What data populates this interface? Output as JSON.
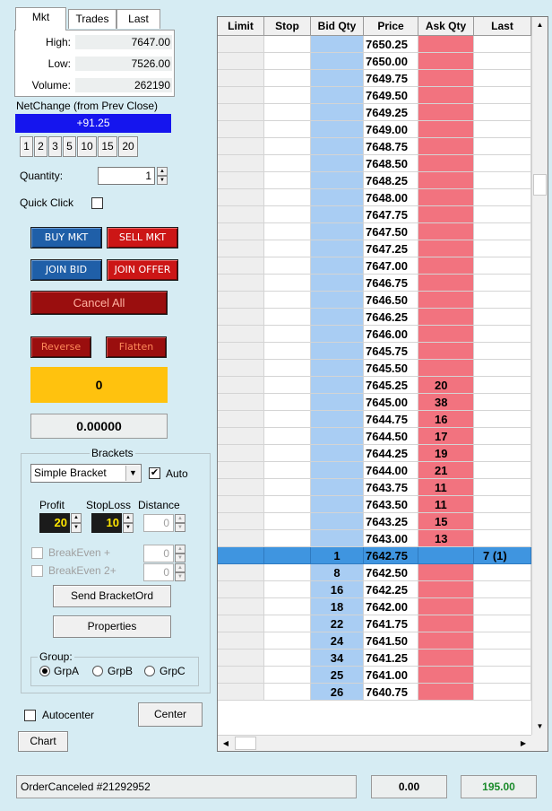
{
  "tabs": [
    "Mkt",
    "Trades",
    "Last"
  ],
  "market": {
    "high_label": "High:",
    "high": "7647.00",
    "low_label": "Low:",
    "low": "7526.00",
    "volume_label": "Volume:",
    "volume": "262190"
  },
  "netchange": {
    "label": "NetChange (from Prev Close)",
    "value": "+91.25"
  },
  "quantity_buttons": [
    "1",
    "2",
    "3",
    "5",
    "10",
    "15",
    "20"
  ],
  "quantity": {
    "label": "Quantity:",
    "value": "1"
  },
  "quick_click_label": "Quick Click",
  "orders": {
    "buy_mkt": "BUY MKT",
    "sell_mkt": "SELL MKT",
    "join_bid": "JOIN BID",
    "join_offer": "JOIN OFFER",
    "cancel_all": "Cancel All",
    "reverse": "Reverse",
    "flatten": "Flatten"
  },
  "position": "0",
  "pnl": "0.00000",
  "brackets": {
    "title": "Brackets",
    "type": "Simple Bracket",
    "auto_label": "Auto",
    "auto_checked": true,
    "profit_label": "Profit",
    "profit": "20",
    "stoploss_label": "StopLoss",
    "stoploss": "10",
    "distance_label": "Distance",
    "distance": "0",
    "breakeven_label": "BreakEven +",
    "breakeven": "0",
    "breakeven2_label": "BreakEven 2+",
    "breakeven2": "0",
    "send_label": "Send BracketOrd",
    "properties_label": "Properties"
  },
  "group": {
    "title": "Group:",
    "options": [
      "GrpA",
      "GrpB",
      "GrpC"
    ],
    "selected": "GrpA"
  },
  "autocenter_label": "Autocenter",
  "center_label": "Center",
  "chart_label": "Chart",
  "ladder": {
    "headers": [
      "Limit",
      "Stop",
      "Bid Qty",
      "Price",
      "Ask Qty",
      "Last"
    ],
    "rows": [
      {
        "price": "7650.25",
        "bid": "",
        "ask": "",
        "last": ""
      },
      {
        "price": "7650.00",
        "bid": "",
        "ask": "",
        "last": ""
      },
      {
        "price": "7649.75",
        "bid": "",
        "ask": "",
        "last": ""
      },
      {
        "price": "7649.50",
        "bid": "",
        "ask": "",
        "last": ""
      },
      {
        "price": "7649.25",
        "bid": "",
        "ask": "",
        "last": ""
      },
      {
        "price": "7649.00",
        "bid": "",
        "ask": "",
        "last": ""
      },
      {
        "price": "7648.75",
        "bid": "",
        "ask": "",
        "last": ""
      },
      {
        "price": "7648.50",
        "bid": "",
        "ask": "",
        "last": ""
      },
      {
        "price": "7648.25",
        "bid": "",
        "ask": "",
        "last": ""
      },
      {
        "price": "7648.00",
        "bid": "",
        "ask": "",
        "last": ""
      },
      {
        "price": "7647.75",
        "bid": "",
        "ask": "",
        "last": ""
      },
      {
        "price": "7647.50",
        "bid": "",
        "ask": "",
        "last": ""
      },
      {
        "price": "7647.25",
        "bid": "",
        "ask": "",
        "last": ""
      },
      {
        "price": "7647.00",
        "bid": "",
        "ask": "",
        "last": ""
      },
      {
        "price": "7646.75",
        "bid": "",
        "ask": "",
        "last": ""
      },
      {
        "price": "7646.50",
        "bid": "",
        "ask": "",
        "last": ""
      },
      {
        "price": "7646.25",
        "bid": "",
        "ask": "",
        "last": ""
      },
      {
        "price": "7646.00",
        "bid": "",
        "ask": "",
        "last": ""
      },
      {
        "price": "7645.75",
        "bid": "",
        "ask": "",
        "last": ""
      },
      {
        "price": "7645.50",
        "bid": "",
        "ask": "",
        "last": ""
      },
      {
        "price": "7645.25",
        "bid": "",
        "ask": "20",
        "last": ""
      },
      {
        "price": "7645.00",
        "bid": "",
        "ask": "38",
        "last": ""
      },
      {
        "price": "7644.75",
        "bid": "",
        "ask": "16",
        "last": ""
      },
      {
        "price": "7644.50",
        "bid": "",
        "ask": "17",
        "last": ""
      },
      {
        "price": "7644.25",
        "bid": "",
        "ask": "19",
        "last": ""
      },
      {
        "price": "7644.00",
        "bid": "",
        "ask": "21",
        "last": ""
      },
      {
        "price": "7643.75",
        "bid": "",
        "ask": "11",
        "last": ""
      },
      {
        "price": "7643.50",
        "bid": "",
        "ask": "11",
        "last": ""
      },
      {
        "price": "7643.25",
        "bid": "",
        "ask": "15",
        "last": ""
      },
      {
        "price": "7643.00",
        "bid": "",
        "ask": "13",
        "last": ""
      },
      {
        "price": "7642.75",
        "bid": "1",
        "ask": "",
        "last": "7 (1)",
        "highlight": true
      },
      {
        "price": "7642.50",
        "bid": "8",
        "ask": "",
        "last": ""
      },
      {
        "price": "7642.25",
        "bid": "16",
        "ask": "",
        "last": ""
      },
      {
        "price": "7642.00",
        "bid": "18",
        "ask": "",
        "last": ""
      },
      {
        "price": "7641.75",
        "bid": "22",
        "ask": "",
        "last": ""
      },
      {
        "price": "7641.50",
        "bid": "24",
        "ask": "",
        "last": ""
      },
      {
        "price": "7641.25",
        "bid": "34",
        "ask": "",
        "last": ""
      },
      {
        "price": "7641.00",
        "bid": "25",
        "ask": "",
        "last": ""
      },
      {
        "price": "7640.75",
        "bid": "26",
        "ask": "",
        "last": ""
      }
    ]
  },
  "status": {
    "message": "OrderCanceled #21292952",
    "value1": "0.00",
    "value2": "195.00"
  },
  "colors": {
    "netchange_bg": "#1515ee",
    "bid": "#a9cdf3",
    "ask": "#f2737f",
    "inside_row": "#3f95e0",
    "position_bg": "#ffc20e",
    "positive_text": "#1a8a2a"
  }
}
